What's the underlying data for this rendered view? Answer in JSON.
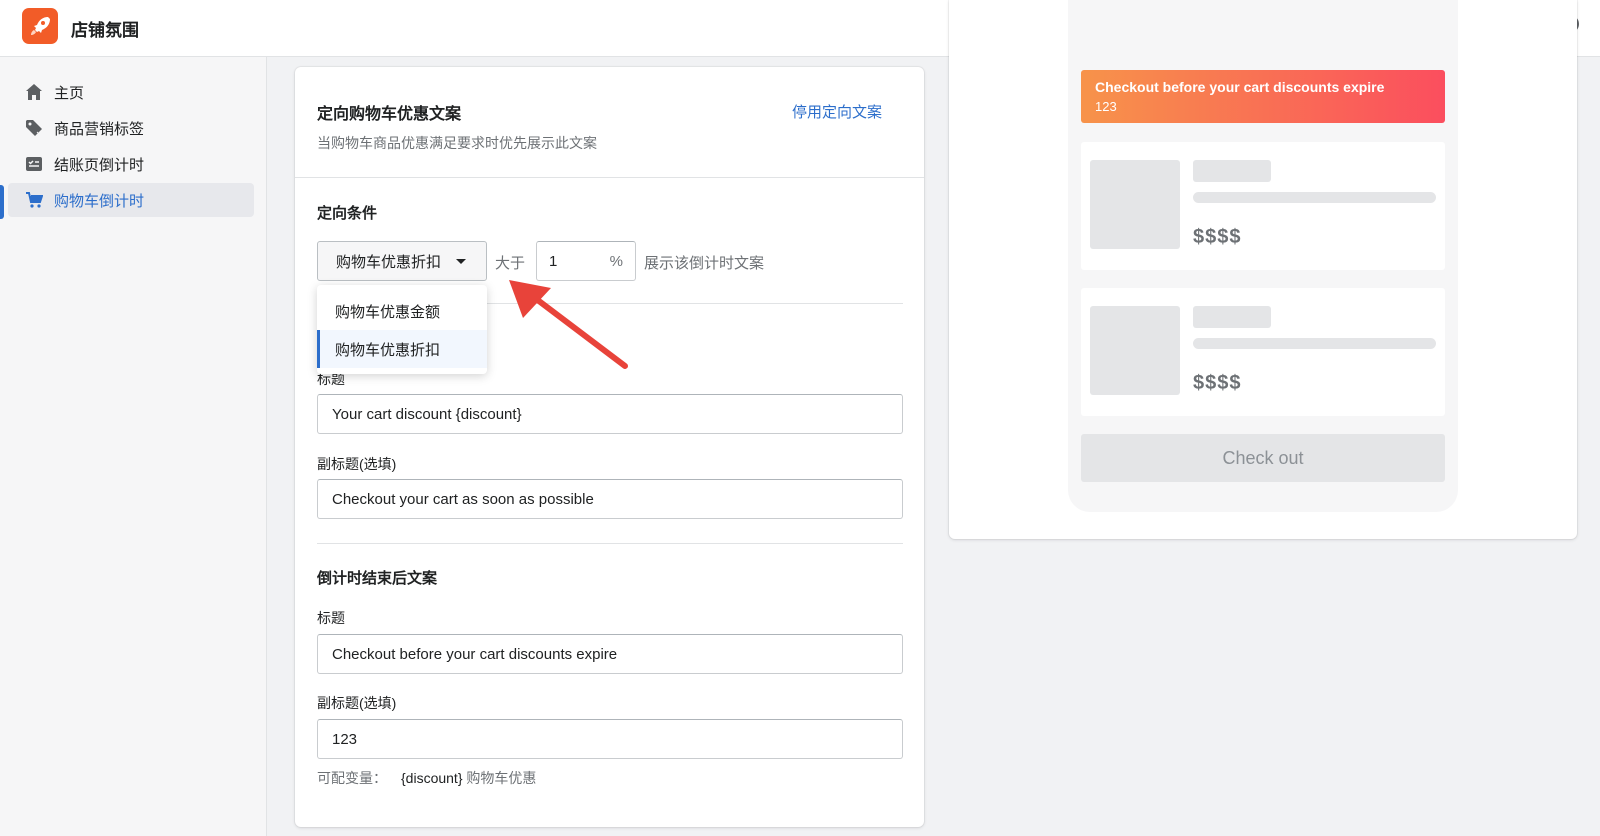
{
  "app": {
    "name": "店铺氛围"
  },
  "header": {
    "store_icon": "store-icon",
    "help_icon": "help-icon"
  },
  "sidebar": {
    "items": [
      {
        "label": "主页",
        "icon": "home-icon"
      },
      {
        "label": "商品营销标签",
        "icon": "tag-icon"
      },
      {
        "label": "结账页倒计时",
        "icon": "checkout-list-icon"
      },
      {
        "label": "购物车倒计时",
        "icon": "cart-icon",
        "active": true
      }
    ]
  },
  "main": {
    "title": "定向购物车优惠文案",
    "subtitle": "当购物车商品优惠满足要求时优先展示此文案",
    "disable_link": "停用定向文案",
    "condition": {
      "section_title": "定向条件",
      "select_value": "购物车优惠折扣",
      "greater_than": "大于",
      "threshold_value": "1",
      "threshold_suffix": "%",
      "trailing_text": "展示该倒计时文案",
      "options": [
        "购物车优惠金额",
        "购物车优惠折扣"
      ],
      "selected_option": "购物车优惠折扣"
    },
    "active_text": {
      "title_label": "标题",
      "title_value": "Your cart discount {discount}",
      "subtitle_label": "副标题(选填)",
      "subtitle_value": "Checkout your cart as soon as possible"
    },
    "after_countdown": {
      "section_title": "倒计时结束后文案",
      "title_label": "标题",
      "title_value": "Checkout before your cart discounts expire",
      "subtitle_label": "副标题(选填)",
      "subtitle_value": "123"
    },
    "variables": {
      "label": "可配变量：",
      "code": "{discount}",
      "desc": "购物车优惠"
    }
  },
  "preview": {
    "banner_title": "Checkout before your cart discounts expire",
    "banner_subtitle": "123",
    "products": [
      {
        "price": "$$$$"
      },
      {
        "price": "$$$$"
      }
    ],
    "checkout_label": "Check out"
  },
  "colors": {
    "accent": "#2c6ecb",
    "logo": "#f25c28",
    "banner_start": "#f7934a",
    "banner_end": "#fb4e5e",
    "annotation_arrow": "#e8433a"
  }
}
